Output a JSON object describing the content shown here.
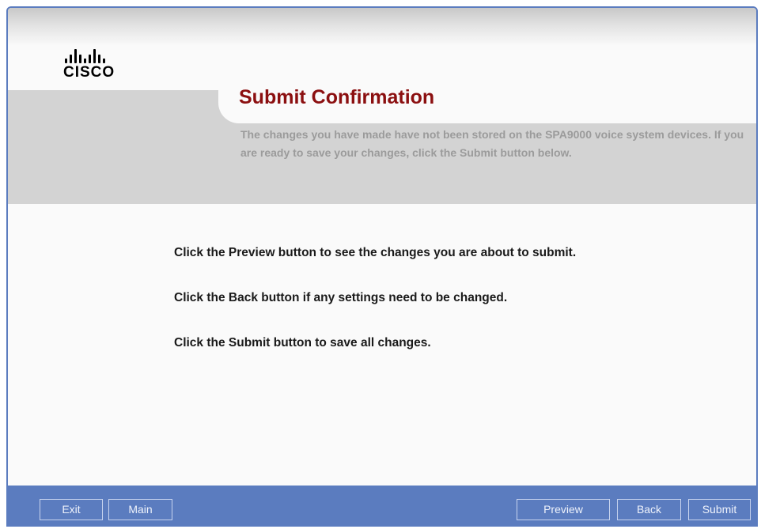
{
  "brand": {
    "logo_word": "CISCO"
  },
  "header": {
    "title": "Submit Confirmation",
    "subtitle": "The changes you have made have not been stored on the SPA9000 voice system devices. If you are ready to save your changes, click the Submit button below."
  },
  "main": {
    "instructions": [
      "Click the Preview button to see the changes you are about to submit.",
      "Click the Back button if any settings need to be changed.",
      "Click the Submit button to save all changes."
    ]
  },
  "footer": {
    "exit_label": "Exit",
    "main_label": "Main",
    "preview_label": "Preview",
    "back_label": "Back",
    "submit_label": "Submit"
  },
  "colors": {
    "frame_blue": "#5b7cbf",
    "title_red": "#8b0f10",
    "band_gray": "#d3d3d3",
    "subtitle_gray": "#9b9b9b"
  }
}
